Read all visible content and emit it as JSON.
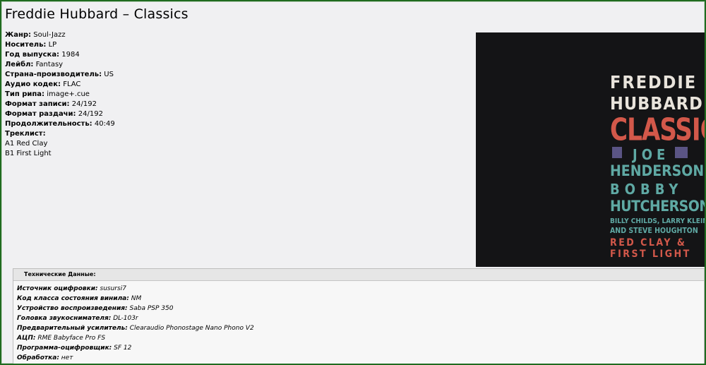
{
  "title": "Freddie Hubbard – Classics",
  "info": [
    {
      "label": "Жанр:",
      "value": "Soul-Jazz"
    },
    {
      "label": "Носитель:",
      "value": "LP"
    },
    {
      "label": "Год выпуска:",
      "value": "1984"
    },
    {
      "label": "Лейбл:",
      "value": "Fantasy"
    },
    {
      "label": "Страна-производитель:",
      "value": "US"
    },
    {
      "label": "Аудио кодек:",
      "value": "FLAC"
    },
    {
      "label": "Тип рипа:",
      "value": "image+.cue"
    },
    {
      "label": "Формат записи:",
      "value": "24/192"
    },
    {
      "label": "Формат раздачи:",
      "value": "24/192"
    },
    {
      "label": "Продолжительность:",
      "value": "40:49"
    }
  ],
  "tracklist_label": "Треклист:",
  "tracks": [
    "A1 Red Clay",
    "B1 First Light"
  ],
  "cover": {
    "line1": "FREDDIE",
    "line2": "HUBBARD",
    "line3": "CLASSICS",
    "line4": "JOE",
    "line5": "HENDERSON",
    "line6": "BOBBY",
    "line7": "HUTCHERSON",
    "line8": "BILLY CHILDS, LARRY KLEIN",
    "line9": "AND STEVE HOUGHTON",
    "line10": "RED CLAY &",
    "line11": "FIRST LIGHT",
    "colors": {
      "background": "#141416",
      "white": "#e9e4dc",
      "red": "#d2584a",
      "teal": "#5fa9a4",
      "purple": "#5a5484"
    }
  },
  "tech": {
    "header": "Технические Данные:",
    "rows": [
      {
        "label": "Источник оцифровки:",
        "value": "susursi7"
      },
      {
        "label": "Код класса состояния винила:",
        "value": "NM"
      },
      {
        "label": "Устройство воспроизведения:",
        "value": "Saba PSP 350"
      },
      {
        "label": "Головка звукоснимателя:",
        "value": "DL-103r"
      },
      {
        "label": "Предварительный усилитель:",
        "value": "Clearaudio Phonostage Nano Phono V2"
      },
      {
        "label": "АЦП:",
        "value": "RME Babyface Pro FS"
      },
      {
        "label": "Программа-оцифровщик:",
        "value": "SF 12"
      },
      {
        "label": "Обработка:",
        "value": "нет"
      }
    ]
  },
  "colors": {
    "frame_border": "#1f6b1f",
    "page_bg": "#f0f0f2"
  }
}
